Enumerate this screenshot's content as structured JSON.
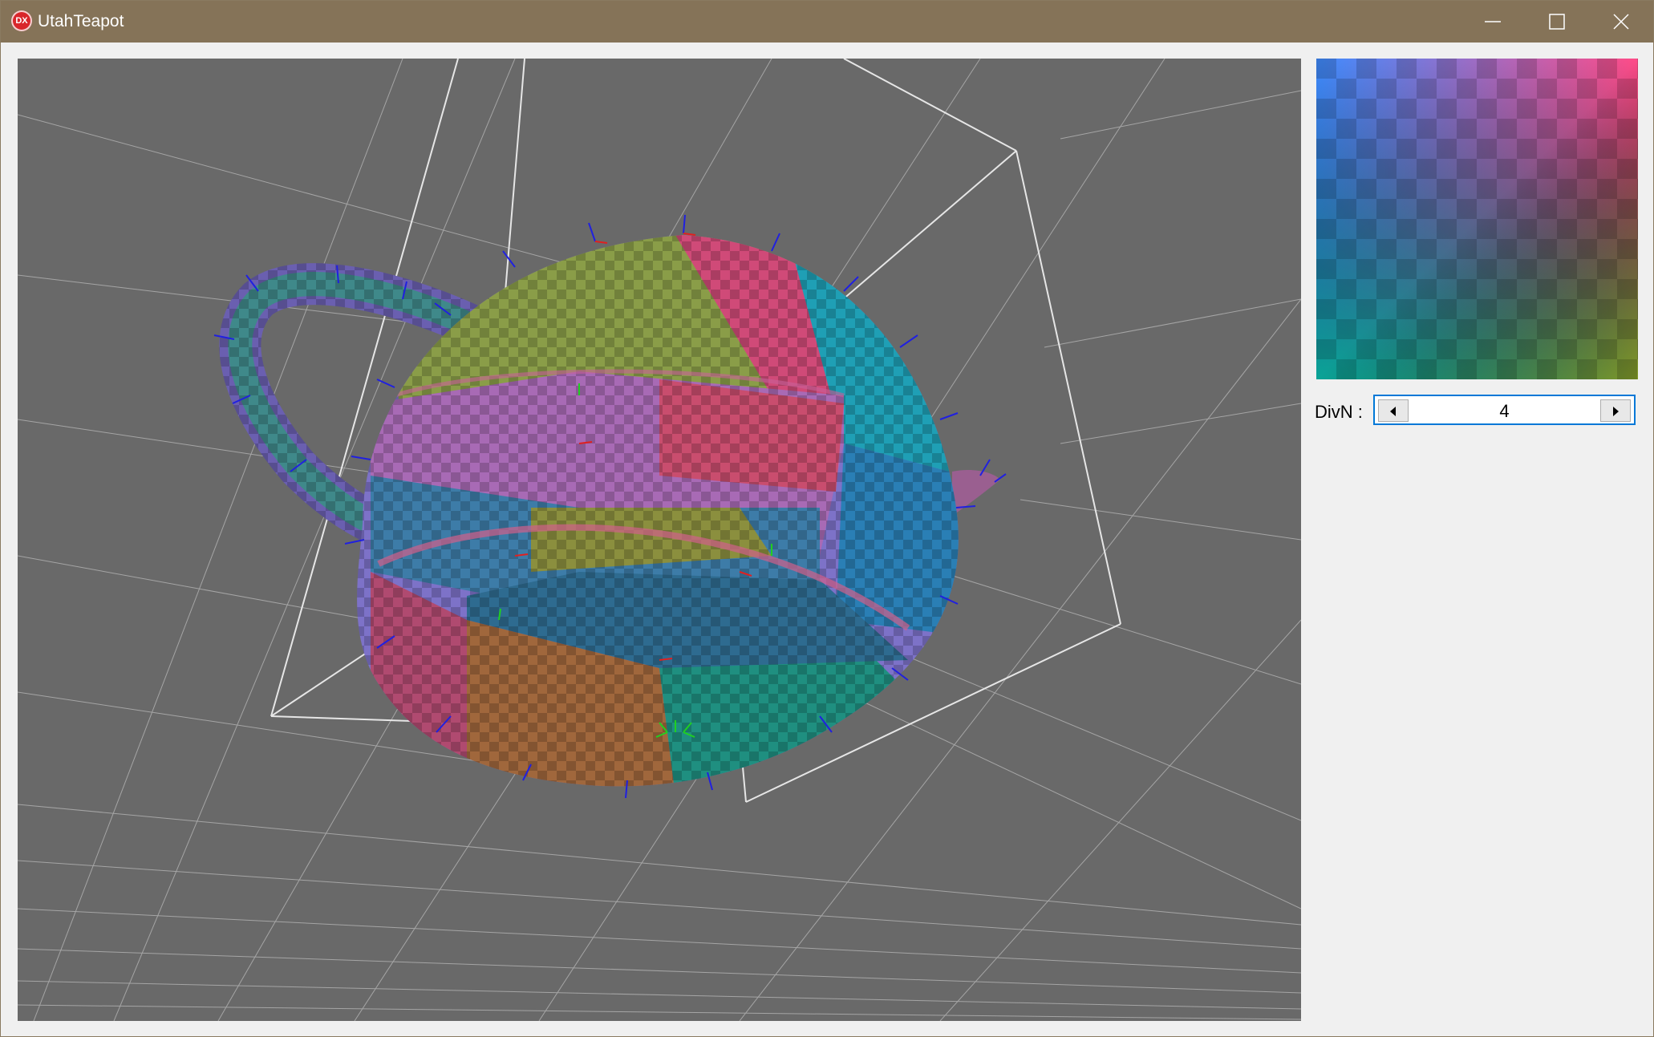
{
  "window": {
    "title": "UtahTeapot",
    "app_icon_text": "DX",
    "controls": [
      "minimize-icon",
      "maximize-icon",
      "close-icon"
    ]
  },
  "viewport": {
    "background": "#696969",
    "grid_color": "#b4b4b4",
    "bbox_color": "#e6e6e6",
    "normal_colors": {
      "n": "#2020e0",
      "t": "#e02020",
      "b": "#20d020"
    }
  },
  "texture": {
    "corners": {
      "top_left": "#3f8cff",
      "top_right": "#ff4c88",
      "bottom_left": "#00b58a",
      "bottom_right": "#a89800"
    }
  },
  "controls": {
    "divn_label": "DivN :",
    "divn_value": "4"
  }
}
